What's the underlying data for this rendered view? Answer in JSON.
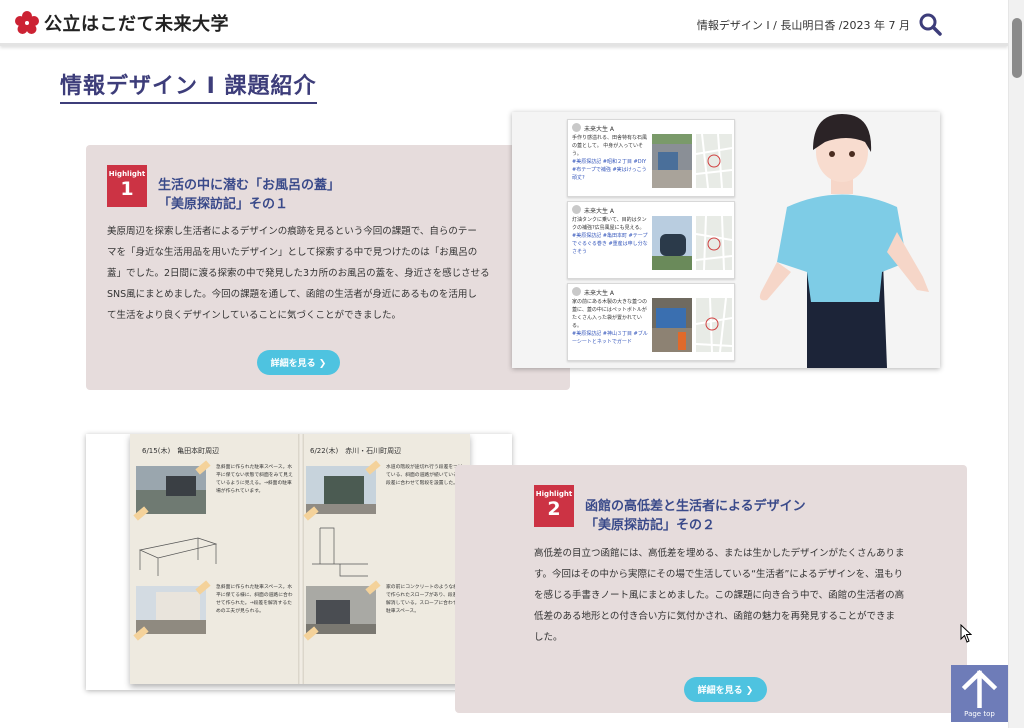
{
  "header": {
    "logo_text": "公立はこだて未来大学",
    "meta": "情報デザイン I / 長山明日香 /2023 年 7 月",
    "brand_color": "#cc2233"
  },
  "page": {
    "title": "情報デザイン I 課題紹介"
  },
  "cards": [
    {
      "badge_label": "Highlight",
      "badge_num": "1",
      "title_line1": "生活の中に潜む「お風呂の蓋」",
      "title_line2": "「美原探訪記」その１",
      "body": [
        "美原周辺を探索し生活者によるデザインの痕跡を見るという今回の課題で、自らのテー",
        "マを「身近な生活用品を用いたデザイン」として探索する中で見つけたのは「お風呂の",
        "蓋」でした。2日間に渡る探索の中で発見した3カ所のお風呂の蓋を、身近さを感じさせる",
        "SNS風にまとめました。今回の課題を通して、函館の生活者が身近にあるものを活用し",
        "て生活をより良くデザインしていることに気づくことができました。"
      ],
      "button": "詳細を見る ❯"
    },
    {
      "badge_label": "Highlight",
      "badge_num": "2",
      "title_line1": "函館の高低差と生活者によるデザイン",
      "title_line2": "「美原探訪記」その２",
      "body": [
        "高低差の目立つ函館には、高低差を埋める、または生かしたデザインがたくさんありま",
        "す。今回はその中から実際にその場で生活している“生活者”によるデザインを、温もり",
        "を感じる手書きノート風にまとめました。この課題に向き合う中で、函館の生活者の高",
        "低差のある地形との付き合い方に気付かされ、函館の魅力を再発見することができま",
        "した。"
      ],
      "button": "詳細を見る ❯"
    }
  ],
  "sns_posts": [
    {
      "user": "未来大生 A",
      "text": "手作り感溢れる、田舎特有な石風の蓋として。 中身が入っていそう。",
      "tags": "#美原探訪記 #昭和２丁目 #DIY #布テープで補強 #実はけっこう頑丈?"
    },
    {
      "user": "未来大生 A",
      "text": "灯油タンクに乗いて、目的はタンクの補強?広島風屋にも見える。",
      "tags": "#美原探訪記 #亀田本町 #テープでぐるぐる巻き #重産は申し分なさそう"
    },
    {
      "user": "未来大生 A",
      "text": "家の前にある木製の大きな蓋つの蓋に、蓋の中にはペットボトルがたくさん入った袋が置かれている。",
      "tags": "#美原探訪記 #神山３丁目 #ブルーシートとネットでガード"
    }
  ],
  "notebook": {
    "left_heading": "6/15(木)　亀田本町周辺",
    "right_heading": "6/22(木)　赤川・石川町周辺",
    "notes": [
      "急斜面に作られた駐車スペース。水平に保てない状態で斜面をみて見えているように見える。→斜面の駐車場が作られています。",
      "水道の階段が途切れ行う段差をつけている、斜面の道路が続いている。段差に合わせて階段を設置した。",
      "急斜面に作られた駐車スペース。水平に保てる様に、斜面の道路に合わせて作られた。→段差を解消するための工夫が見られる。",
      "家の前にコンクリートのような斜面で作られたスロープがあり、段差を解消している。スロープに合わせた駐車スペース。"
    ]
  },
  "pagetop": {
    "label": "Page top"
  }
}
